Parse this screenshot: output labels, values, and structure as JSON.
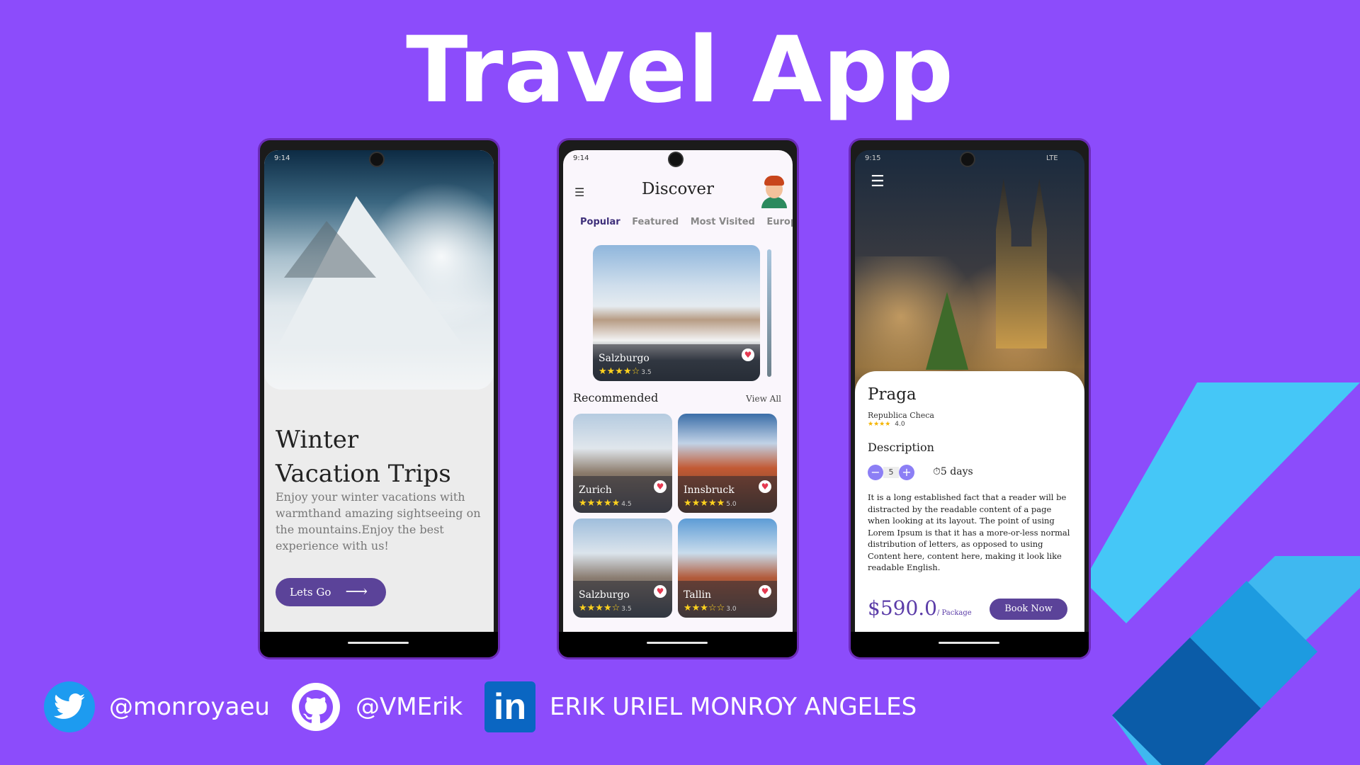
{
  "banner": {
    "title": "Travel App"
  },
  "phone1": {
    "heading_line1": "Winter",
    "heading_line2": "Vacation Trips",
    "description": "Enjoy your winter vacations with warmthand amazing sightseeing on the mountains.Enjoy the best experience with us!",
    "cta_label": "Lets Go",
    "status_time": "9:14"
  },
  "phone2": {
    "status_time": "9:14",
    "title": "Discover",
    "tabs": [
      {
        "label": "Popular",
        "active": true
      },
      {
        "label": "Featured",
        "active": false
      },
      {
        "label": "Most Visited",
        "active": false
      },
      {
        "label": "Europe",
        "active": false
      }
    ],
    "hero": {
      "name": "Salzburgo",
      "stars": "★★★★☆",
      "rating": "3.5"
    },
    "recommended_label": "Recommended",
    "view_all_label": "View All",
    "recommended": [
      {
        "name": "Zurich",
        "stars": "★★★★★",
        "rating": "4.5"
      },
      {
        "name": "Innsbruck",
        "stars": "★★★★★",
        "rating": "5.0"
      },
      {
        "name": "Salzburgo",
        "stars": "★★★★☆",
        "rating": "3.5"
      },
      {
        "name": "Tallin",
        "stars": "★★★☆☆",
        "rating": "3.0"
      }
    ]
  },
  "phone3": {
    "status_time": "9:15",
    "network": "LTE",
    "city": "Praga",
    "country": "Republica Checa",
    "stars": "★★★★",
    "rating": "4.0",
    "description_title": "Description",
    "quantity": "5",
    "duration": "5 days",
    "body": "It is a long established fact that a reader will be distracted by the readable content of a page when looking at its layout. The point of using Lorem Ipsum is that it has a more-or-less normal distribution of letters, as opposed to using Content here, content here, making it look like readable English.",
    "price": "$590.0",
    "price_unit": "/ Package",
    "book_label": "Book Now"
  },
  "footer": {
    "twitter": "@monroyaeu",
    "github": "@VMErik",
    "linkedin": "ERIK URIEL MONROY ANGELES",
    "linkedin_logo": "in"
  },
  "colors": {
    "background": "#8c4cfb",
    "accent": "#5b4399",
    "flutter_light": "#45c7f7",
    "flutter_dark": "#0b5ca8"
  }
}
